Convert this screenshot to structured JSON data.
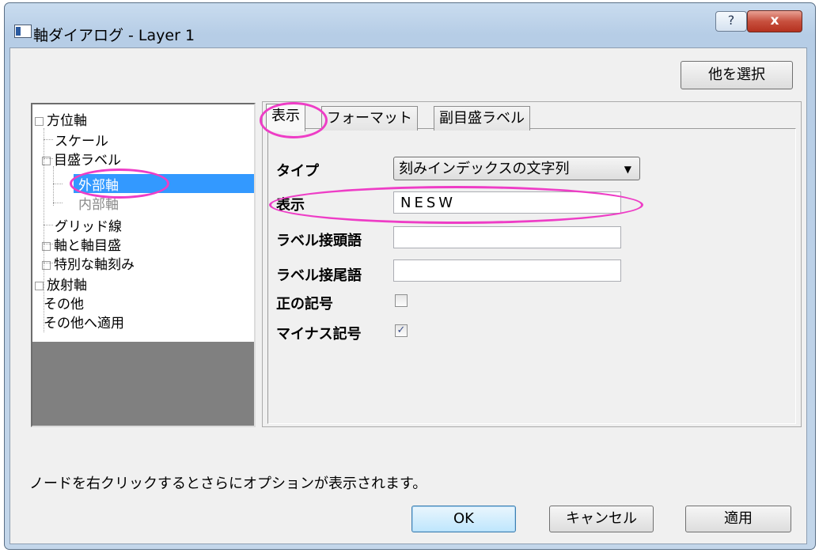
{
  "window": {
    "title": "軸ダイアログ - Layer 1",
    "help_glyph": "?",
    "close_glyph": "x"
  },
  "toolbar": {
    "select_other_label": "他を選択"
  },
  "tree": {
    "items": [
      {
        "label": "方位軸",
        "level": 0,
        "state": "normal"
      },
      {
        "label": "スケール",
        "level": 1,
        "state": "normal"
      },
      {
        "label": "目盛ラベル",
        "level": 1,
        "state": "normal"
      },
      {
        "label": "外部軸",
        "level": 2,
        "state": "selected"
      },
      {
        "label": "内部軸",
        "level": 2,
        "state": "disabled"
      },
      {
        "label": "グリッド線",
        "level": 1,
        "state": "normal"
      },
      {
        "label": "軸と軸目盛",
        "level": 1,
        "state": "normal"
      },
      {
        "label": "特別な軸刻み",
        "level": 1,
        "state": "normal"
      },
      {
        "label": "放射軸",
        "level": 0,
        "state": "normal"
      },
      {
        "label": "その他",
        "level": 0,
        "state": "normal"
      },
      {
        "label": "その他へ適用",
        "level": 0,
        "state": "normal"
      }
    ]
  },
  "tabs": [
    {
      "label": "表示",
      "active": true
    },
    {
      "label": "フォーマット",
      "active": false
    },
    {
      "label": "副目盛ラベル",
      "active": false
    }
  ],
  "form": {
    "type_label": "タイプ",
    "type_value": "刻みインデックスの文字列",
    "display_label": "表示",
    "display_value": "NESW",
    "prefix_label": "ラベル接頭語",
    "prefix_value": "",
    "suffix_label": "ラベル接尾語",
    "suffix_value": "",
    "plus_sign_label": "正の記号",
    "plus_sign_checked": false,
    "minus_sign_label": "マイナス記号",
    "minus_sign_checked": true
  },
  "hint": "ノードを右クリックするとさらにオプションが表示されます。",
  "buttons": {
    "ok": "OK",
    "cancel": "キャンセル",
    "apply": "適用"
  },
  "colors": {
    "annotation": "#ee3dc6",
    "selection": "#3399ff",
    "titlebar": "#c9dcef",
    "close_button": "#c7503e"
  }
}
